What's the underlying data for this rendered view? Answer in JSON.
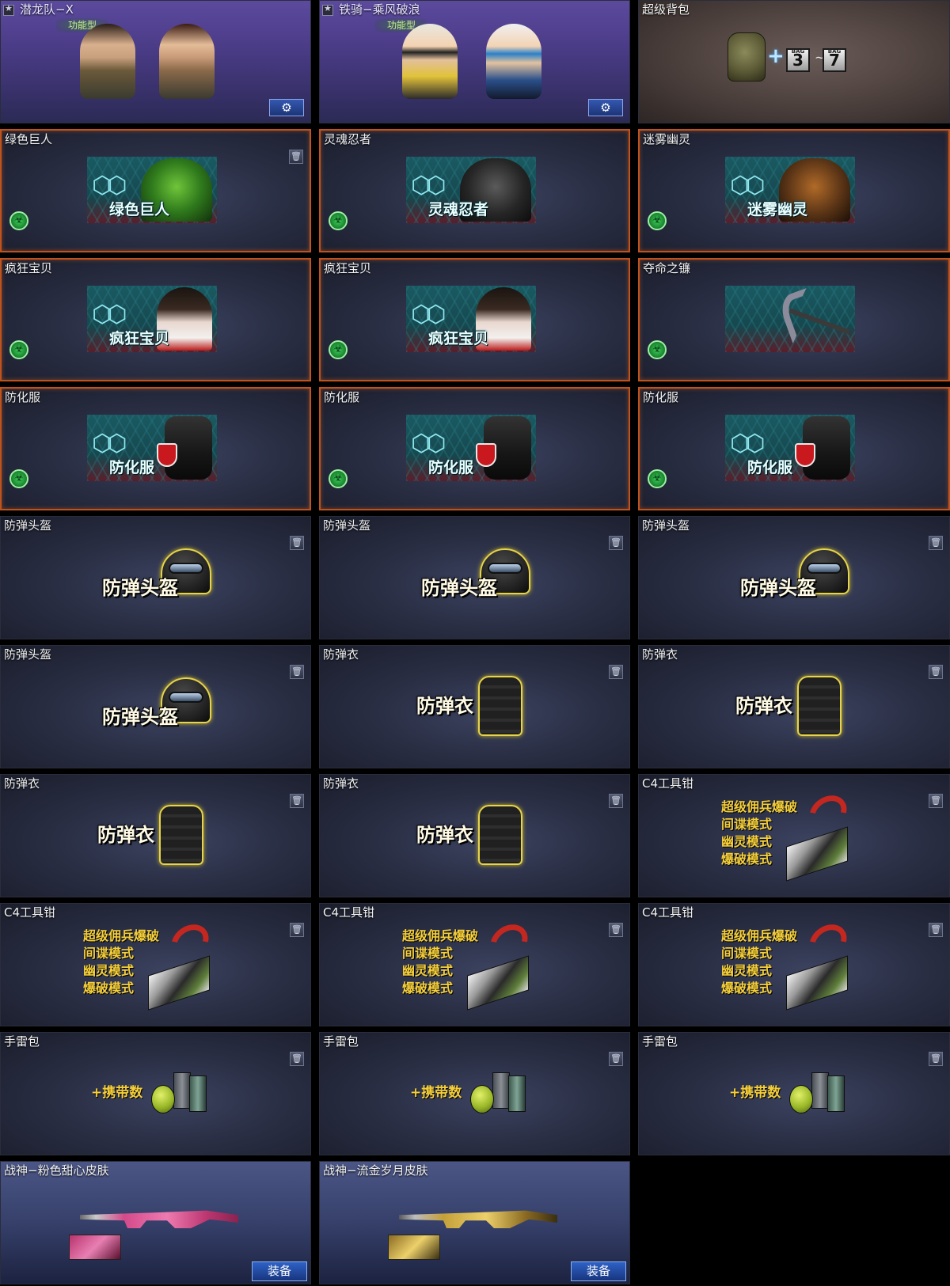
{
  "colors": {
    "highlight_border": "#c2521c",
    "button_blue": "#2f62c6",
    "badge_text": "#cfe89a",
    "item_label_gold": "#f5cf3a"
  },
  "cards": {
    "c0": {
      "title": "潜龙队−X",
      "badge": "功能型",
      "icon": "gear-icon"
    },
    "c1": {
      "title": "铁骑−乘风破浪",
      "badge": "功能型",
      "icon": "gear-icon"
    },
    "c2": {
      "title": "超级背包",
      "bag_tag": "BAG",
      "bag_from": "3",
      "bag_to": "7",
      "tilde": "~",
      "plus": "+"
    },
    "c3": {
      "title": "绿色巨人",
      "label": "绿色巨人"
    },
    "c4": {
      "title": "灵魂忍者",
      "label": "灵魂忍者"
    },
    "c5": {
      "title": "迷雾幽灵",
      "label": "迷雾幽灵"
    },
    "c6": {
      "title": "疯狂宝贝",
      "label": "疯狂宝贝"
    },
    "c7": {
      "title": "疯狂宝贝",
      "label": "疯狂宝贝"
    },
    "c8": {
      "title": "夺命之镰"
    },
    "c9": {
      "title": "防化服",
      "label": "防化服"
    },
    "c10": {
      "title": "防化服",
      "label": "防化服"
    },
    "c11": {
      "title": "防化服",
      "label": "防化服"
    },
    "c12": {
      "title": "防弹头盔",
      "label": "防弹头盔"
    },
    "c13": {
      "title": "防弹头盔",
      "label": "防弹头盔"
    },
    "c14": {
      "title": "防弹头盔",
      "label": "防弹头盔"
    },
    "c15": {
      "title": "防弹头盔",
      "label": "防弹头盔"
    },
    "c16": {
      "title": "防弹衣",
      "label": "防弹衣"
    },
    "c17": {
      "title": "防弹衣",
      "label": "防弹衣"
    },
    "c18": {
      "title": "防弹衣",
      "label": "防弹衣"
    },
    "c19": {
      "title": "防弹衣",
      "label": "防弹衣"
    },
    "c20": {
      "title": "C4工具钳",
      "modes": [
        "超级佣兵爆破",
        "间谍模式",
        "幽灵模式",
        "爆破模式"
      ]
    },
    "c21": {
      "title": "C4工具钳",
      "modes": [
        "超级佣兵爆破",
        "间谍模式",
        "幽灵模式",
        "爆破模式"
      ]
    },
    "c22": {
      "title": "C4工具钳",
      "modes": [
        "超级佣兵爆破",
        "间谍模式",
        "幽灵模式",
        "爆破模式"
      ]
    },
    "c23": {
      "title": "C4工具钳",
      "modes": [
        "超级佣兵爆破",
        "间谍模式",
        "幽灵模式",
        "爆破模式"
      ]
    },
    "c24": {
      "title": "手雷包",
      "label": "+携带数"
    },
    "c25": {
      "title": "手雷包",
      "label": "+携带数"
    },
    "c26": {
      "title": "手雷包",
      "label": "+携带数"
    },
    "c27": {
      "title": "战神−粉色甜心皮肤",
      "button": "装备"
    },
    "c28": {
      "title": "战神−流金岁月皮肤",
      "button": "装备"
    }
  }
}
